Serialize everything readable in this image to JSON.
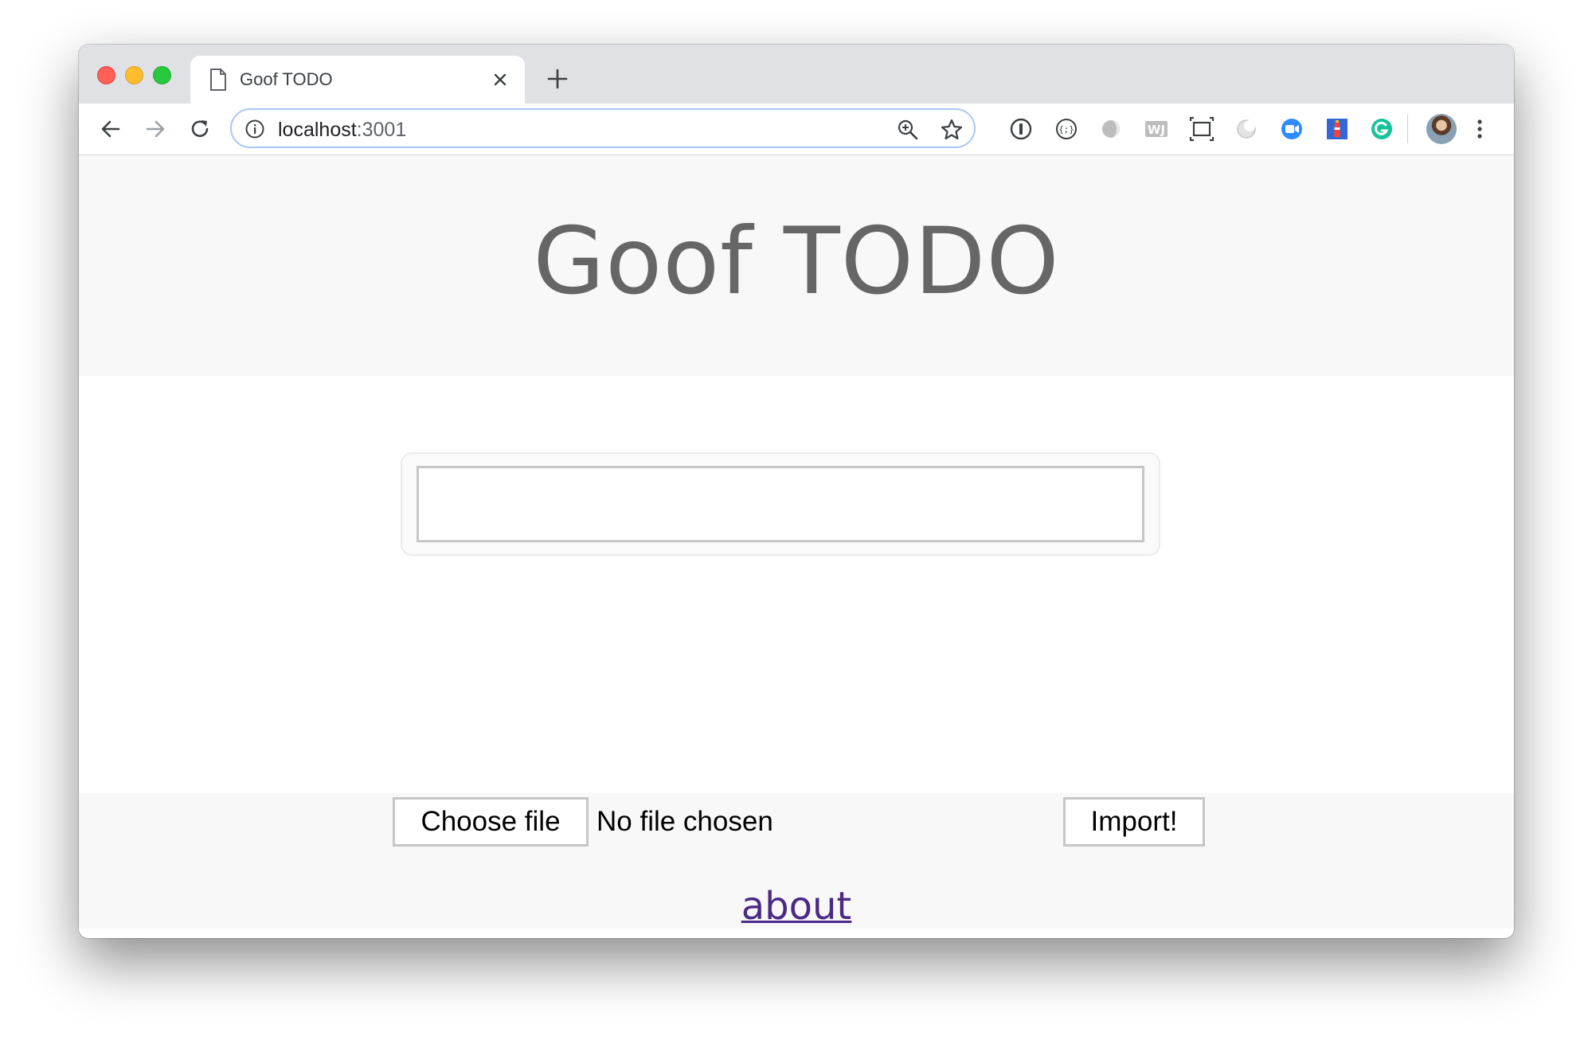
{
  "browser": {
    "tab": {
      "title": "Goof TODO",
      "icon": "document-icon"
    },
    "address_bar": {
      "host": "localhost",
      "port": ":3001"
    },
    "extensions": [
      "onepassword-icon",
      "json-viewer-icon",
      "dark-reader-icon",
      "wj-extension-icon",
      "screenshot-icon",
      "moon-icon",
      "zoom-icon",
      "lighthouse-icon",
      "grammarly-icon"
    ]
  },
  "page": {
    "title": "Goof TODO",
    "todo_input": {
      "value": "",
      "placeholder": ""
    },
    "import": {
      "choose_file_label": "Choose file",
      "file_status": "No file chosen",
      "import_label": "Import!"
    },
    "about_link": "about"
  },
  "colors": {
    "title_text": "#666666",
    "header_bg": "#f8f8f8",
    "link": "#4b2a86",
    "omnibox_border": "#a8c7fa"
  }
}
